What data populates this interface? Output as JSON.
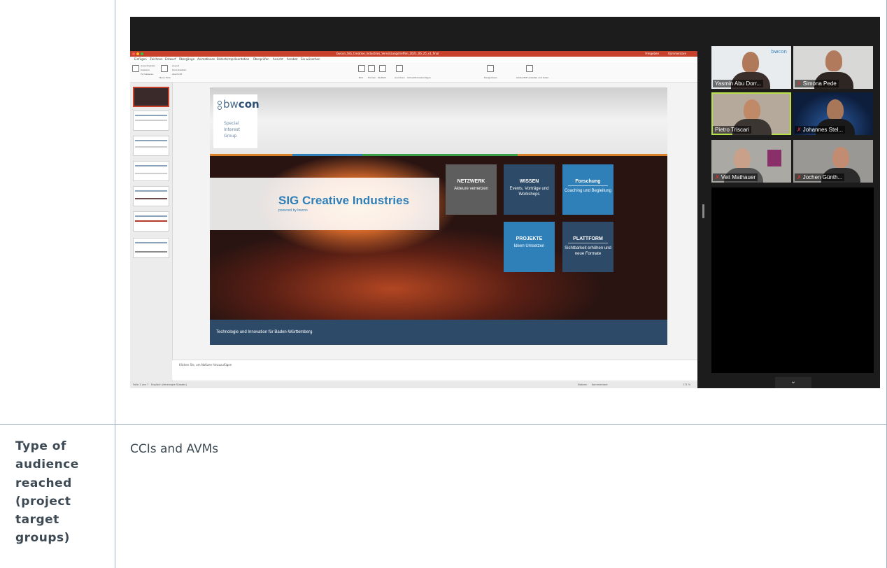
{
  "ppt": {
    "title_bar": "bwcon_SIG_Creative_Industries_Vernetzungstreffen_2021_06_25_v1_final",
    "share": "Freigeben",
    "comments": "Kommentare",
    "menu": [
      "Einfügen",
      "Zeichnen",
      "Entwurf",
      "Übergänge",
      "Animationen",
      "Bildschirmpräsentation",
      "Überprüfen",
      "Ansicht",
      "Acrobat",
      "Sie wünschen"
    ],
    "ribbon": [
      "Ausschneiden",
      "Kopieren",
      "Formatieren",
      "Neue Folie",
      "Layout",
      "Zurücksetzen",
      "Abschnitt",
      "Bild",
      "Formen",
      "Textfeld",
      "Anordnen",
      "Schnellformatvorlagen",
      "Designideen",
      "Adobe PDF erstellen und teilen"
    ],
    "notes_placeholder": "Klicken Sie, um Notizen hinzuzufügen",
    "status_left": "Folie 1 von 7",
    "status_lang": "Englisch (Vereinigte Staaten)",
    "status_notes": "Notizen",
    "status_comments": "Kommentare",
    "zoom": "171 %"
  },
  "slide": {
    "logo": "bwcon",
    "logo_pre": "bw",
    "logo_post": "con",
    "logo_sub_1": "Special",
    "logo_sub_2": "Interest",
    "logo_sub_3": "Group",
    "hero_title": "SIG Creative Industries",
    "hero_sub": "powered by bwcon",
    "tiles": [
      {
        "head": "NETZWERK",
        "body": "Akteure vernetzen"
      },
      {
        "head": "WISSEN",
        "body": "Events, Vorträge und Workshops"
      },
      {
        "head": "Forschung",
        "body": "Coaching und Begleitung"
      },
      {
        "head": "PROJEKTE",
        "body": "Ideen Umsetzen"
      },
      {
        "head": "PLATTFORM",
        "body": "Sichtbarkeit erhöhen und neue Formate"
      }
    ],
    "footer": "Technologie und Innovation für Baden-Württemberg",
    "colors": {
      "blue": "#2f7fb8",
      "grey_tile": "#5e5e5e",
      "navy_tile": "#2d4b68",
      "light_blue_tile": "#2f7fb8",
      "footer": "#2d4b68"
    }
  },
  "participants": [
    {
      "name": "Yasmin Abu Dorr...",
      "muted": false,
      "speaking": false,
      "badge": "bwcon"
    },
    {
      "name": "Simona Pede",
      "muted": true,
      "speaking": false
    },
    {
      "name": "Pietro Triscari",
      "muted": false,
      "speaking": true
    },
    {
      "name": "Johannes Stel...",
      "muted": true,
      "speaking": false
    },
    {
      "name": "Veit Mathauer",
      "muted": true,
      "speaking": false
    },
    {
      "name": "Jochen Günth...",
      "muted": true,
      "speaking": false
    }
  ],
  "table": {
    "label": "Type of audience reached (project target groups)",
    "label_lines": [
      "Type of",
      "audience",
      "reached",
      "(project",
      "target",
      "groups)"
    ],
    "value": "CCIs and AVMs"
  },
  "icons": {
    "scroll_down": "chevron-down-icon",
    "mic_muted": "mic-off-icon"
  }
}
